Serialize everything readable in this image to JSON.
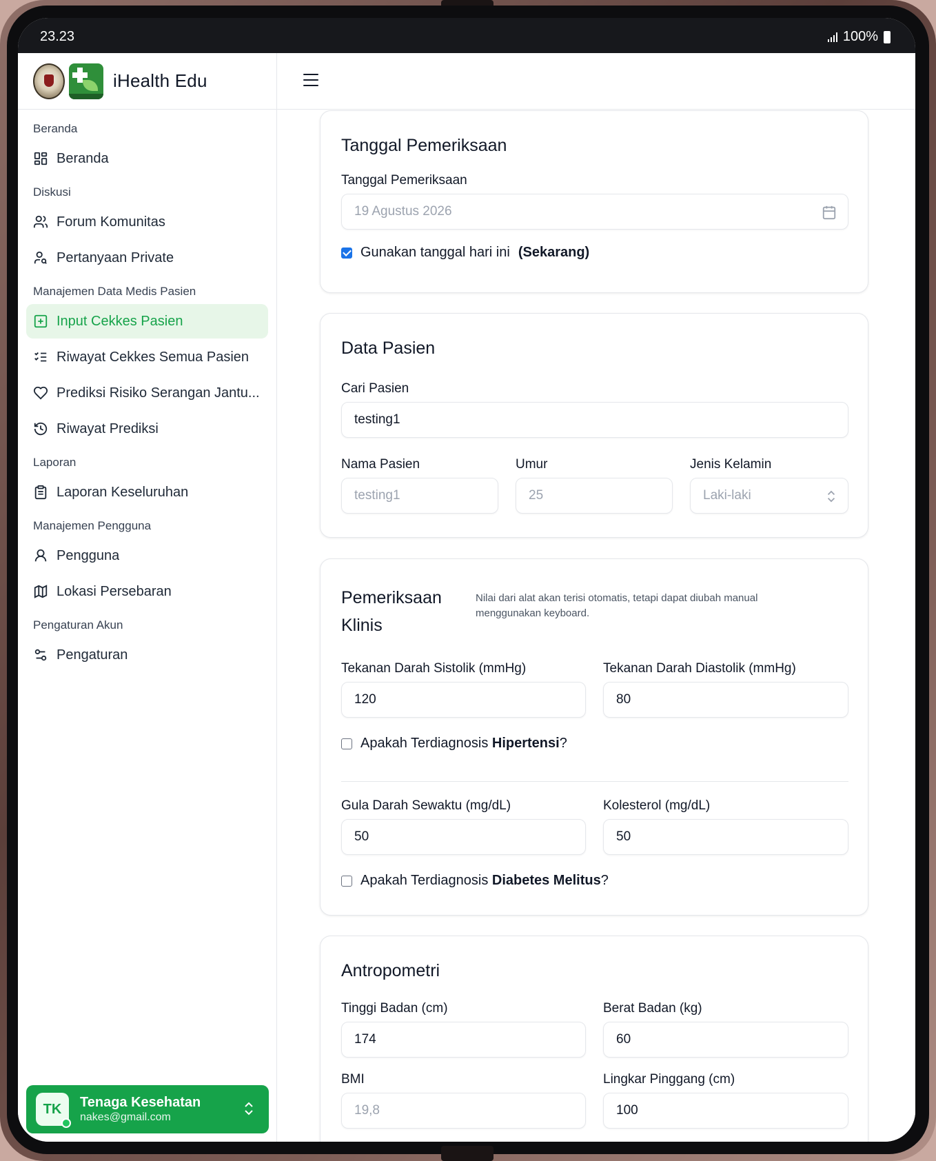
{
  "status": {
    "time": "23.23",
    "battery": "100%"
  },
  "brand": {
    "name": "iHealth Edu"
  },
  "sidebar": {
    "sections": [
      {
        "title": "Beranda",
        "items": [
          {
            "label": "Beranda",
            "icon": "dashboard-icon"
          }
        ]
      },
      {
        "title": "Diskusi",
        "items": [
          {
            "label": "Forum Komunitas",
            "icon": "users-icon"
          },
          {
            "label": "Pertanyaan Private",
            "icon": "user-search-icon"
          }
        ]
      },
      {
        "title": "Manajemen Data Medis Pasien",
        "items": [
          {
            "label": "Input Cekkes Pasien",
            "icon": "plus-square-icon",
            "active": true
          },
          {
            "label": "Riwayat Cekkes Semua Pasien",
            "icon": "list-check-icon"
          },
          {
            "label": "Prediksi Risiko Serangan Jantu...",
            "icon": "heart-icon"
          },
          {
            "label": "Riwayat Prediksi",
            "icon": "history-icon"
          }
        ]
      },
      {
        "title": "Laporan",
        "items": [
          {
            "label": "Laporan Keseluruhan",
            "icon": "clipboard-icon"
          }
        ]
      },
      {
        "title": "Manajemen Pengguna",
        "items": [
          {
            "label": "Pengguna",
            "icon": "user-icon"
          },
          {
            "label": "Lokasi Persebaran",
            "icon": "map-icon"
          }
        ]
      },
      {
        "title": "Pengaturan Akun",
        "items": [
          {
            "label": "Pengaturan",
            "icon": "settings-sliders-icon"
          }
        ]
      }
    ],
    "user": {
      "initials": "TK",
      "name": "Tenaga Kesehatan",
      "email": "nakes@gmail.com"
    }
  },
  "tanggal": {
    "title": "Tanggal Pemeriksaan",
    "label": "Tanggal Pemeriksaan",
    "value": "19 Agustus 2026",
    "checkbox_label": "Gunakan tanggal hari ini",
    "checkbox_strong": "(Sekarang)",
    "checked": true
  },
  "pasien": {
    "title": "Data Pasien",
    "search_label": "Cari Pasien",
    "search_value": "testing1",
    "nama_label": "Nama Pasien",
    "nama_value": "testing1",
    "umur_label": "Umur",
    "umur_value": "25",
    "jk_label": "Jenis Kelamin",
    "jk_value": "Laki-laki"
  },
  "klinis": {
    "title_line1": "Pemeriksaan",
    "title_line2": "Klinis",
    "note": "Nilai dari alat akan terisi otomatis, tetapi dapat diubah manual menggunakan keyboard.",
    "sistolik_label": "Tekanan Darah Sistolik (mmHg)",
    "sistolik_value": "120",
    "diastolik_label": "Tekanan Darah Diastolik (mmHg)",
    "diastolik_value": "80",
    "hipertensi_pre": "Apakah Terdiagnosis ",
    "hipertensi_strong": "Hipertensi",
    "hipertensi_post": "?",
    "gula_label": "Gula Darah Sewaktu (mg/dL)",
    "gula_value": "50",
    "kolesterol_label": "Kolesterol (mg/dL)",
    "kolesterol_value": "50",
    "diabetes_pre": "Apakah Terdiagnosis ",
    "diabetes_strong": "Diabetes Melitus",
    "diabetes_post": "?"
  },
  "antropometri": {
    "title": "Antropometri",
    "tinggi_label": "Tinggi Badan (cm)",
    "tinggi_value": "174",
    "berat_label": "Berat Badan (kg)",
    "berat_value": "60",
    "bmi_label": "BMI",
    "bmi_value": "19,8",
    "pinggang_label": "Lingkar Pinggang (cm)",
    "pinggang_value": "100"
  },
  "colors": {
    "accent": "#16a34a",
    "active_bg": "#e7f6e8",
    "checkbox": "#1a73e8"
  }
}
